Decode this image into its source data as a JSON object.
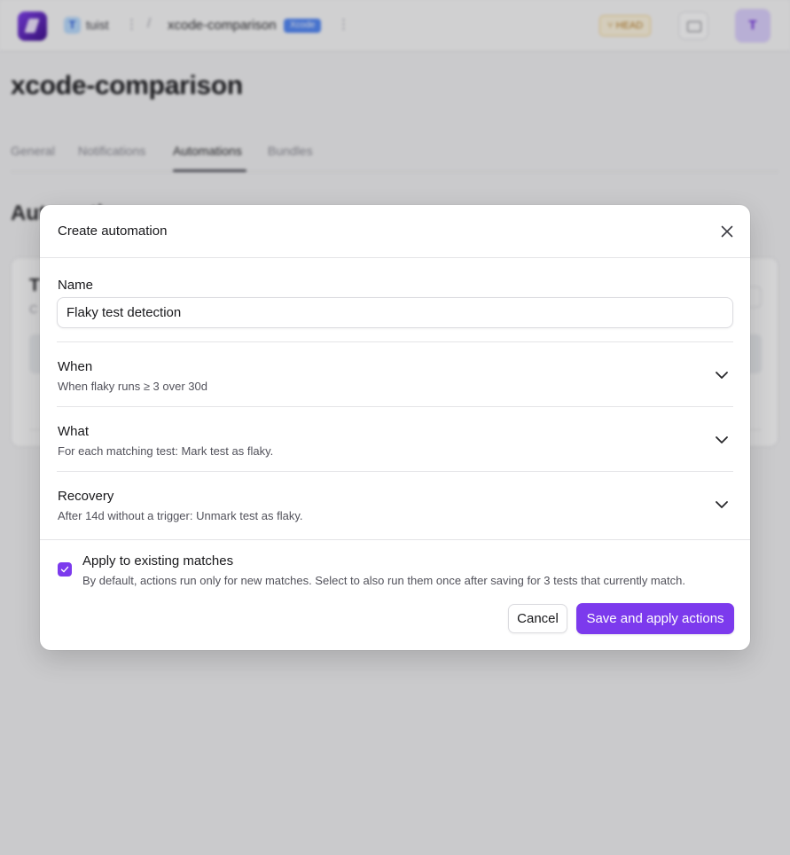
{
  "header": {
    "org_initial": "T",
    "org_name": "tuist",
    "separator": "/",
    "project_name": "xcode-comparison",
    "project_badge": "Xcode",
    "branch_label": "HEAD",
    "user_initial": "T"
  },
  "page": {
    "title": "xcode-comparison",
    "tabs": [
      {
        "label": "General"
      },
      {
        "label": "Notifications"
      },
      {
        "label": "Automations"
      },
      {
        "label": "Bundles"
      }
    ],
    "active_tab": "Automations",
    "section_title": "Automations",
    "card_title": "T",
    "card_subtitle": "C"
  },
  "modal": {
    "title": "Create automation",
    "name_label": "Name",
    "name_value": "Flaky test detection",
    "sections": [
      {
        "label": "When",
        "summary": "When flaky runs ≥ 3 over 30d"
      },
      {
        "label": "What",
        "summary": "For each matching test: Mark test as flaky."
      },
      {
        "label": "Recovery",
        "summary": "After 14d without a trigger: Unmark test as flaky."
      }
    ],
    "apply_existing": {
      "checked": true,
      "label": "Apply to existing matches",
      "help": "By default, actions run only for new matches. Select to also run them once after saving for 3 tests that currently match."
    },
    "cancel_label": "Cancel",
    "save_label": "Save and apply actions"
  },
  "colors": {
    "accent": "#7c3aed",
    "badge": "#4f86f7",
    "branch": "#b7791f"
  }
}
